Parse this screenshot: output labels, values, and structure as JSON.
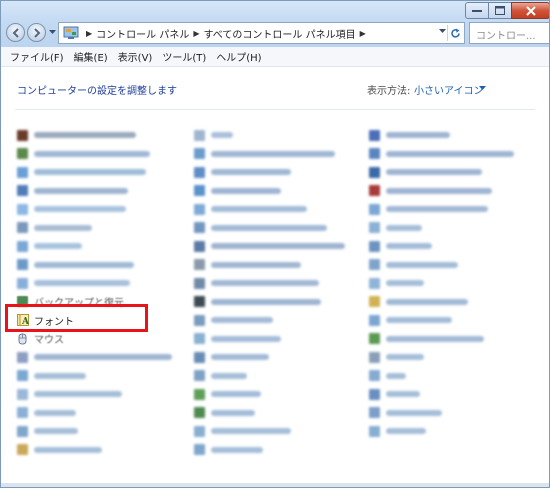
{
  "address": {
    "crumbs": [
      "コントロール パネル",
      "すべてのコントロール パネル項目"
    ]
  },
  "search": {
    "placeholder": "コントロー..."
  },
  "menu": [
    "ファイル(F)",
    "編集(E)",
    "表示(V)",
    "ツール(T)",
    "ヘルプ(H)"
  ],
  "content": {
    "heading": "コンピューターの設定を調整します",
    "view_by_label": "表示方法:",
    "view_by_value": "小さいアイコン"
  },
  "visible_items": {
    "backup": "バックアップと復元",
    "fonts": "フォント",
    "mouse": "マウス"
  },
  "colors": {
    "highlight": "#e8141a",
    "link": "#1e5fb4",
    "heading": "#1e3c99"
  }
}
